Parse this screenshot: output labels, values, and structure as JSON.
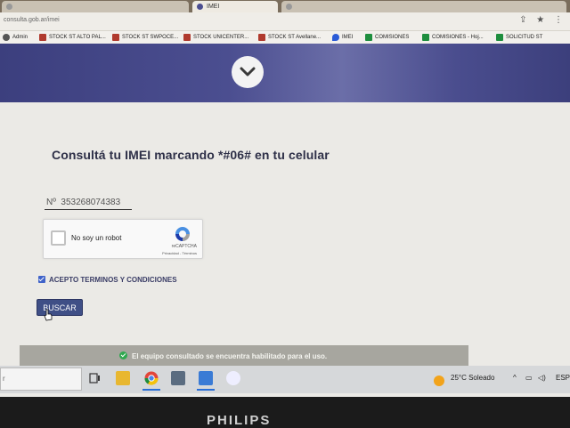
{
  "browser": {
    "tabs": [
      {
        "label": ""
      },
      {
        "label": "IMEI"
      },
      {
        "label": ""
      }
    ],
    "url": "consulta.gob.ar/imei",
    "bookmarks": [
      {
        "label": "Admin",
        "icon": "person-icon"
      },
      {
        "label": "STOCK ST ALTO PAL...",
        "icon": "bookmark-icon"
      },
      {
        "label": "STOCK ST SWPOCE...",
        "icon": "bookmark-icon"
      },
      {
        "label": "STOCK UNICENTER...",
        "icon": "bookmark-icon"
      },
      {
        "label": "STOCK ST Avellane...",
        "icon": "bookmark-icon"
      },
      {
        "label": "IMEI",
        "icon": "drop-icon"
      },
      {
        "label": "COMISIONES",
        "icon": "sheet-icon"
      },
      {
        "label": "COMISIONES - Hoj...",
        "icon": "sheet-icon"
      },
      {
        "label": "SOLICITUD ST",
        "icon": "sheet-icon"
      }
    ]
  },
  "main": {
    "heading": "Consultá tu IMEI marcando *#06# en tu celular",
    "imei_field": {
      "value": "Nº  353268074383"
    },
    "recaptcha": {
      "label": "No soy un robot",
      "brand": "reCAPTCHA",
      "links": "Privacidad - Términos"
    },
    "terms": {
      "label": "ACEPTO TERMINOS Y CONDICIONES",
      "checked": true
    },
    "submit_label": "BUSCAR",
    "result": {
      "message": "El equipo consultado se encuentra habilitado para el uso.",
      "status_color": "#2fa84f"
    }
  },
  "taskbar": {
    "search_text": "r",
    "weather": "25°C  Soleado",
    "language": "ESP"
  },
  "monitor": {
    "brand": "PHILIPS"
  },
  "colors": {
    "hero": "#4b4e90",
    "button": "#3f4f86",
    "accent": "#3f63c9"
  }
}
